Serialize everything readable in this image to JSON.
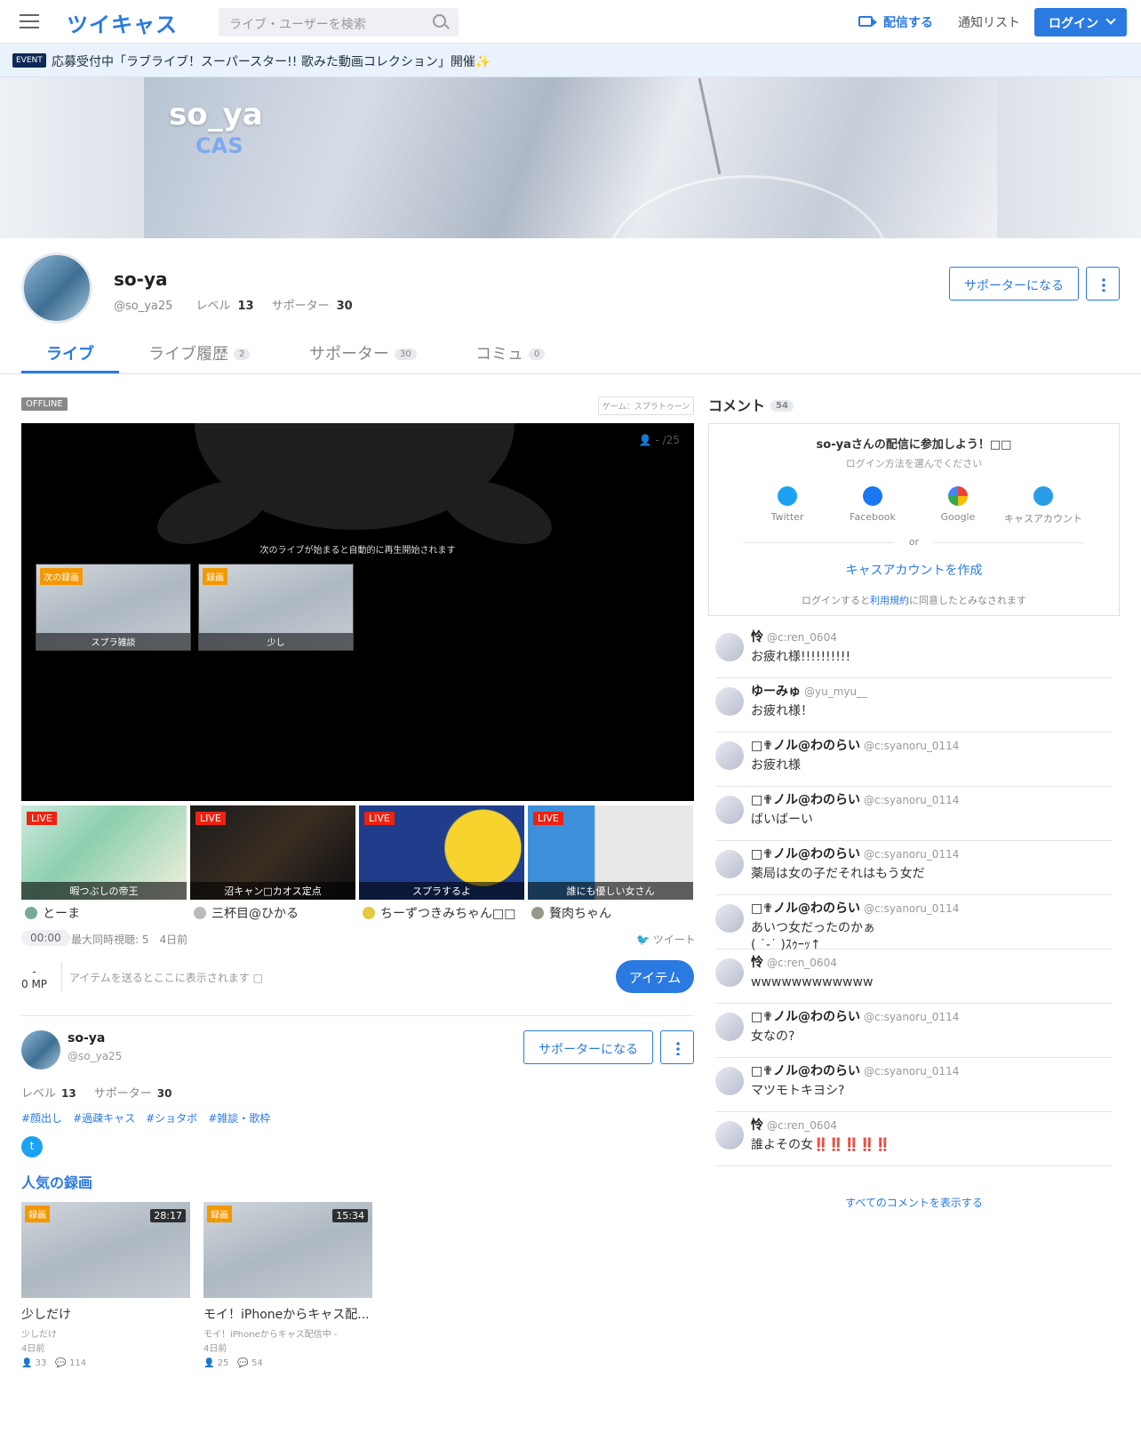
{
  "header": {
    "logo": "ツイキャス",
    "search_placeholder": "ライブ・ユーザーを検索",
    "broadcast": "配信する",
    "notify": "通知リスト",
    "login": "ログイン"
  },
  "event": {
    "badge": "EVENT",
    "text": "応募受付中「ラブライブ！スーパースター!! 歌みた動画コレクション」開催✨"
  },
  "banner": {
    "title": "so_ya",
    "sub": "CAS"
  },
  "profile": {
    "name": "so-ya",
    "id": "@so_ya25",
    "level_label": "レベル",
    "level": "13",
    "supporter_label": "サポーター",
    "supporters": "30",
    "support_btn": "サポーターになる"
  },
  "tabs": [
    {
      "label": "ライブ",
      "count": ""
    },
    {
      "label": "ライブ履歴",
      "count": "2"
    },
    {
      "label": "サポーター",
      "count": "30"
    },
    {
      "label": "コミュ",
      "count": "0"
    }
  ],
  "player": {
    "status": "OFFLINE",
    "game_tag": "ゲーム：スプラトゥーン",
    "viewers": "- /25",
    "auto_text": "次のライブが始まると自動的に再生開始されます",
    "next": [
      {
        "tag": "次の録画",
        "title": "スプラ雑談"
      },
      {
        "tag": "録画",
        "title": "少し"
      }
    ]
  },
  "live_rec": [
    {
      "tag": "LIVE",
      "title": "暇つぶしの帝王",
      "user": "とーま"
    },
    {
      "tag": "LIVE",
      "title": "沼キャン□カオス定点",
      "user": "三杯目@ひかる"
    },
    {
      "tag": "LIVE",
      "title": "スプラするよ",
      "user": "ちーずつきみちゃん□□"
    },
    {
      "tag": "LIVE",
      "title": "誰にも優しい女さん",
      "user": "贅肉ちゃん"
    }
  ],
  "stats": {
    "timer": "00:00",
    "peak": "最大同時視聴: 5",
    "ago": "4日前",
    "tweet": "ツイート"
  },
  "items": {
    "mp_dash": "-",
    "mp": "0 MP",
    "placeholder": "アイテムを送るとここに表示されます □",
    "button": "アイテム"
  },
  "about": {
    "name": "so-ya",
    "id": "@so_ya25",
    "level_label": "レベル",
    "level": "13",
    "supporter_label": "サポーター",
    "supporters": "30",
    "support_btn": "サポーターになる",
    "tags": [
      "#顔出し",
      "#過疎キャス",
      "#ショタボ",
      "#雑談・歌枠"
    ]
  },
  "popular": {
    "title": "人気の録画",
    "items": [
      {
        "tag": "録画",
        "duration": "28:17",
        "title": "少しだけ",
        "sub": "少しだけ",
        "ago": "4日前",
        "views": "33",
        "comments": "114"
      },
      {
        "tag": "録画",
        "duration": "15:34",
        "title": "モイ！iPhoneからキャス配...",
        "sub": "モイ！iPhoneからキャス配信中 -",
        "ago": "4日前",
        "views": "25",
        "comments": "54"
      }
    ]
  },
  "comments": {
    "title": "コメント",
    "count": "54",
    "login": {
      "title": "so-yaさんの配信に参加しよう！□□",
      "sub": "ログイン方法を選んでください",
      "twitter": "Twitter",
      "facebook": "Facebook",
      "google": "Google",
      "cas": "キャスアカウント",
      "or": "or",
      "create": "キャスアカウントを作成",
      "agree_pre": "ログインすると",
      "agree_link": "利用規約",
      "agree_post": "に同意したとみなされます"
    },
    "list": [
      {
        "name": "怜",
        "id": "@c:ren_0604",
        "text": "お疲れ様!!!!!!!!!!"
      },
      {
        "name": "ゆーみゅ",
        "id": "@yu_myu__",
        "text": "お疲れ様！"
      },
      {
        "name": "□✟ノル@わのらい",
        "id": "@c:syanoru_0114",
        "text": "お疲れ様"
      },
      {
        "name": "□✟ノル@わのらい",
        "id": "@c:syanoru_0114",
        "text": "ばいばーい"
      },
      {
        "name": "□✟ノル@わのらい",
        "id": "@c:syanoru_0114",
        "text": "薬局は女の子だそれはもう女だ"
      },
      {
        "name": "□✟ノル@わのらい",
        "id": "@c:syanoru_0114",
        "text": "あいつ女だったのかぁ\n( ˙-˙ )ｽｩｰｯ↑"
      },
      {
        "name": "怜",
        "id": "@c:ren_0604",
        "text": "wwwwwwwwwwww"
      },
      {
        "name": "□✟ノル@わのらい",
        "id": "@c:syanoru_0114",
        "text": "女なの?"
      },
      {
        "name": "□✟ノル@わのらい",
        "id": "@c:syanoru_0114",
        "text": "マツモトキヨシ?"
      },
      {
        "name": "怜",
        "id": "@c:ren_0604",
        "text": "誰よその女‼️‼️‼️‼️‼️"
      }
    ],
    "show_all": "すべてのコメントを表示する"
  },
  "colors": {
    "accent": "#2a7ae2",
    "live": "#ee2211",
    "rec": "#f39800"
  }
}
